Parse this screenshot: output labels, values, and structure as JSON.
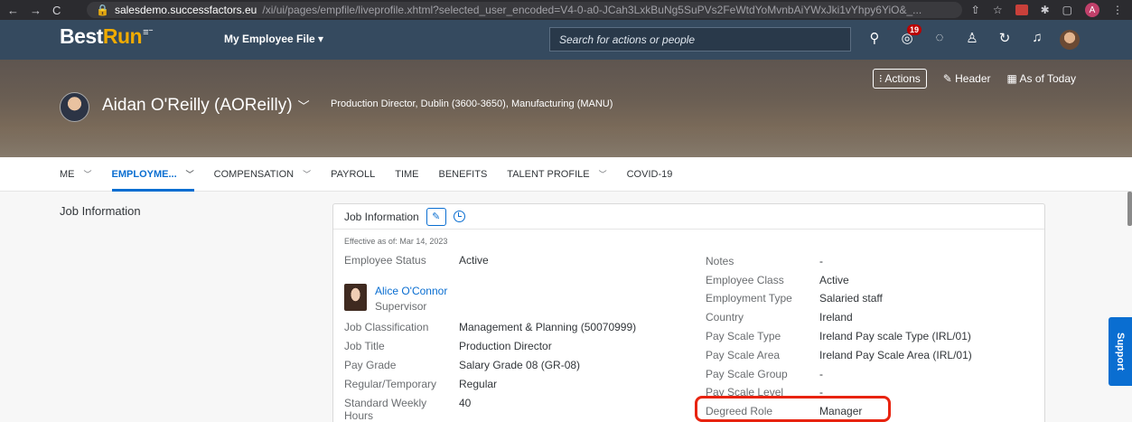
{
  "browser": {
    "url_host": "salesdemo.successfactors.eu",
    "url_path": "/xi/ui/pages/empfile/liveprofile.xhtml?selected_user_encoded=V4-0-a0-JCah3LxkBuNg5SuPVs2FeWtdYoMvnbAiYWxJki1vYhpy6YiO&_...",
    "profile_initial": "A",
    "back_glyph": "←",
    "forward_glyph": "→",
    "reload_glyph": "C"
  },
  "shell": {
    "logo_best": "Best",
    "logo_run": "Run",
    "module_menu": "My Employee File",
    "search_placeholder": "Search for actions or people",
    "notification_count": "19"
  },
  "header": {
    "actions_label": "Actions",
    "header_label": "Header",
    "as_of_label": "As of Today",
    "employee_name": "Aidan O'Reilly (AOReilly)",
    "employee_subtitle": "Production Director, Dublin (3600-3650), Manufacturing (MANU)"
  },
  "tabs": [
    {
      "label": "ME",
      "dropdown": true,
      "active": false
    },
    {
      "label": "EMPLOYME...",
      "dropdown": true,
      "active": true
    },
    {
      "label": "COMPENSATION",
      "dropdown": true,
      "active": false
    },
    {
      "label": "PAYROLL",
      "dropdown": false,
      "active": false
    },
    {
      "label": "TIME",
      "dropdown": false,
      "active": false
    },
    {
      "label": "BENEFITS",
      "dropdown": false,
      "active": false
    },
    {
      "label": "TALENT PROFILE",
      "dropdown": true,
      "active": false
    },
    {
      "label": "COVID-19",
      "dropdown": false,
      "active": false
    }
  ],
  "content": {
    "section_title": "Job Information",
    "card_title": "Job Information",
    "effective_date": "Effective as of: Mar 14, 2023",
    "left_fields": {
      "employee_status": {
        "label": "Employee Status",
        "value": "Active"
      },
      "job_classification": {
        "label": "Job Classification",
        "value": "Management & Planning (50070999)"
      },
      "job_title": {
        "label": "Job Title",
        "value": "Production Director"
      },
      "pay_grade": {
        "label": "Pay Grade",
        "value": "Salary Grade 08 (GR-08)"
      },
      "regular_temporary": {
        "label": "Regular/Temporary",
        "value": "Regular"
      },
      "standard_weekly_hours": {
        "label_line1": "Standard Weekly",
        "label_line2": "Hours",
        "value": "40"
      }
    },
    "supervisor": {
      "name": "Alice O'Connor",
      "role": "Supervisor"
    },
    "right_fields": {
      "notes": {
        "label": "Notes",
        "value": "-"
      },
      "employee_class": {
        "label": "Employee Class",
        "value": "Active"
      },
      "employment_type": {
        "label": "Employment Type",
        "value": "Salaried staff"
      },
      "country": {
        "label": "Country",
        "value": "Ireland"
      },
      "pay_scale_type": {
        "label": "Pay Scale Type",
        "value": "Ireland Pay scale Type (IRL/01)"
      },
      "pay_scale_area": {
        "label": "Pay Scale Area",
        "value": "Ireland Pay Scale Area (IRL/01)"
      },
      "pay_scale_group": {
        "label": "Pay Scale Group",
        "value": "-"
      },
      "pay_scale_level": {
        "label": "Pay Scale Level",
        "value": "-"
      },
      "degreed_role": {
        "label": "Degreed Role",
        "value": "Manager"
      }
    }
  },
  "support_label": "Support",
  "colors": {
    "accent": "#0a6ed1",
    "shell": "#354a5f",
    "highlight": "#e8230f",
    "logo_run": "#f0ab00"
  }
}
